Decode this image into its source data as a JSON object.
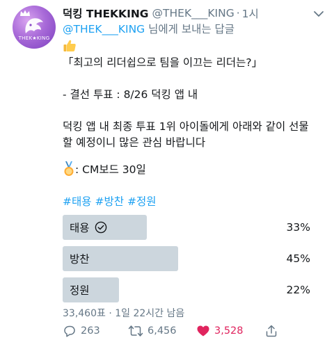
{
  "tweet": {
    "author_name": "덕킹 THEKKING",
    "author_handle": "@THEK___KING",
    "separator": "·",
    "time": "1시",
    "avatar_text": "THEK★KING",
    "reply_mention": "@THEK___KING",
    "reply_suffix": " 님에게 보내는 답글",
    "lines": [
      "「최고의 리더쉽으로 팀을 이끄는 리더는?」",
      "- 결선 투표 : 8/26 덕킹 앱 내",
      "덕킹 앱 내 최종 투표 1위 아이돌에게 아래와 같이 선물",
      "할 예정이니 많은 관심 바랍니다",
      " : CM보드 30일"
    ],
    "hashtags": [
      "#태용",
      "#방찬",
      "#정원"
    ]
  },
  "poll": {
    "options": [
      {
        "label": "태용",
        "percent_label": "33%",
        "percent": 33,
        "selected": true
      },
      {
        "label": "방찬",
        "percent_label": "45%",
        "percent": 45,
        "selected": false
      },
      {
        "label": "정원",
        "percent_label": "22%",
        "percent": 22,
        "selected": false
      }
    ],
    "meta": "33,460표 · 1일 22시간 남음"
  },
  "actions": {
    "replies": "263",
    "retweets": "6,456",
    "likes": "3,528"
  },
  "colors": {
    "link": "#1da1f2",
    "secondary_text": "#657786",
    "poll_bar": "#ccd6dd",
    "like": "#e0245e"
  }
}
